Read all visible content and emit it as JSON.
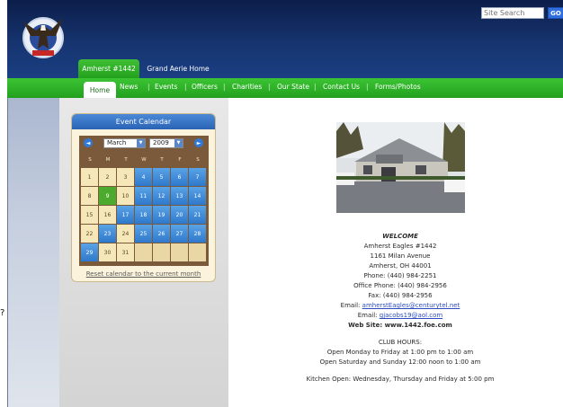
{
  "header": {
    "search_placeholder": "Site Search",
    "search_button": "GO",
    "tabs": [
      {
        "label": "Amherst #1442",
        "active": true
      },
      {
        "label": "Grand Aerie Home",
        "active": false
      }
    ]
  },
  "nav": {
    "items": [
      "Home",
      "News",
      "Events",
      "Officers",
      "Charities",
      "Our State",
      "Contact Us",
      "Forms/Photos"
    ],
    "separator": "|"
  },
  "stray_mark": "?",
  "calendar": {
    "title": "Event Calendar",
    "prev": "◄",
    "next": "►",
    "month": "March",
    "year": "2009",
    "weekdays": [
      "S",
      "M",
      "T",
      "W",
      "T",
      "F",
      "S"
    ],
    "weeks": [
      [
        "1",
        "2",
        "3",
        "4",
        "5",
        "6",
        "7"
      ],
      [
        "8",
        "9",
        "10",
        "11",
        "12",
        "13",
        "14"
      ],
      [
        "15",
        "16",
        "17",
        "18",
        "19",
        "20",
        "21"
      ],
      [
        "22",
        "23",
        "24",
        "25",
        "26",
        "27",
        "28"
      ],
      [
        "29",
        "30",
        "31",
        "",
        "",
        "",
        ""
      ]
    ],
    "today": "9",
    "reset_label": "Reset calendar to the current month"
  },
  "content": {
    "welcome": "WELCOME",
    "org_name": "Amherst Eagles #1442",
    "street": "1161 Milan Avenue",
    "city": "Amherst, OH 44001",
    "phone": "Phone: (440) 984-2251",
    "office_phone": "Office Phone: (440) 984-2956",
    "fax": "Fax: (440) 984-2956",
    "email_label": "Email:",
    "email": "amherstEagles@centurytel.net",
    "email2_label": "Email:",
    "email2": "gjacobs19@aol.com",
    "website": "Web Site: www.1442.foe.com",
    "hours_title": "CLUB HOURS:",
    "hours_weekday": "Open Monday to Friday at 1:00 pm to 1:00 am",
    "hours_weekend": "Open Saturday and Sunday 12:00 noon to 1:00 am",
    "kitchen": "Kitchen Open: Wednesday, Thursday and Friday at 5:00 pm"
  },
  "colors": {
    "header_navy": "#16346f",
    "nav_green": "#2db527",
    "calendar_blue": "#2e78cc",
    "today_green": "#4caa2f",
    "link_blue": "#2e4cc2"
  },
  "icons": {
    "logo": "eagle-emblem-icon",
    "prev": "arrow-left-icon",
    "next": "arrow-right-icon",
    "dropdown": "chevron-down-icon"
  }
}
